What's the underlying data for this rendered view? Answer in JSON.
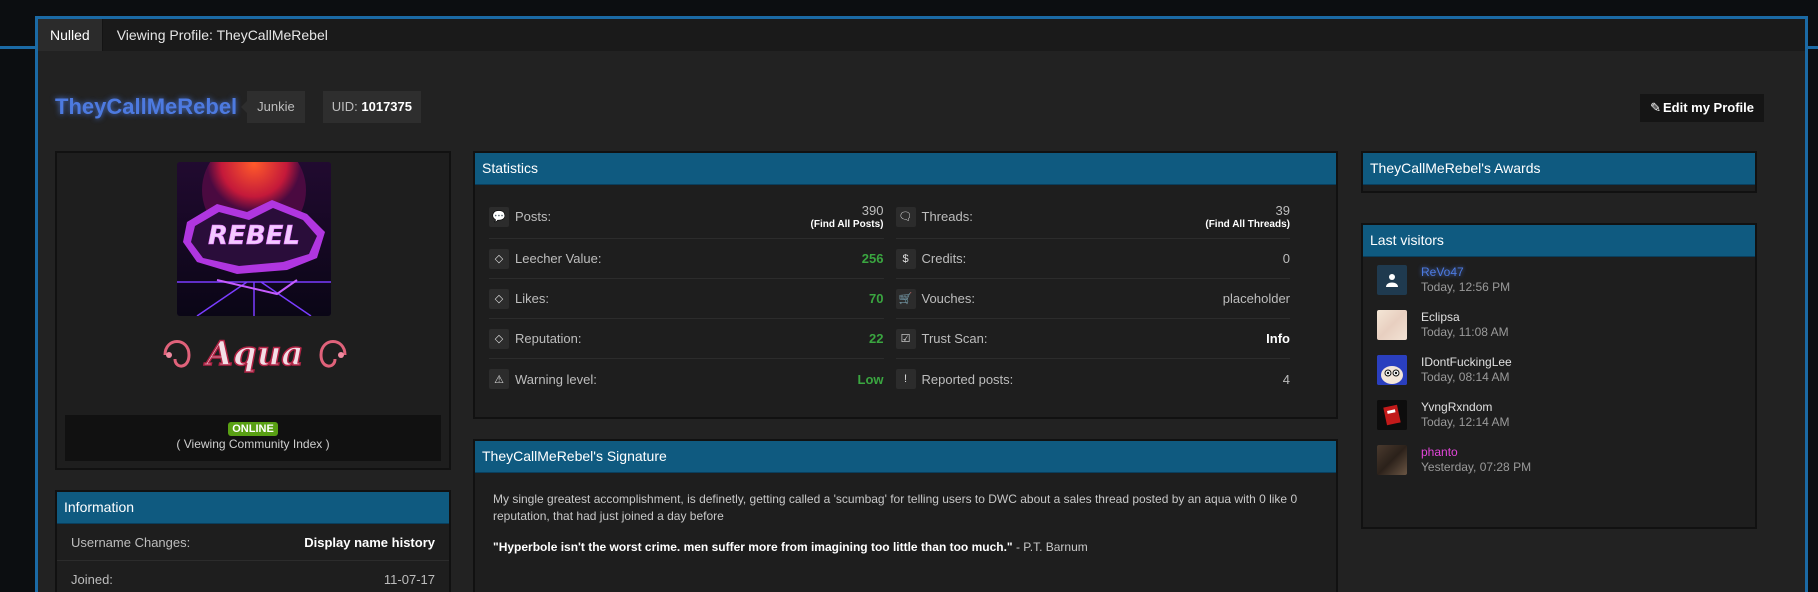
{
  "breadcrumb": {
    "home": "Nulled",
    "page": "Viewing Profile: TheyCallMeRebel"
  },
  "profile": {
    "username": "TheyCallMeRebel",
    "usergroup": "Junkie",
    "uid_label": "UID:",
    "uid_value": "1017375",
    "edit_button": "Edit my Profile",
    "avatar_text": "REBEL",
    "badge_text": "Aqua",
    "status_badge": "ONLINE",
    "status_activity": "( Viewing Community Index )"
  },
  "information": {
    "title": "Information",
    "rows": [
      {
        "label": "Username Changes:",
        "value": "Display name history"
      },
      {
        "label": "Joined:",
        "value": "11-07-17"
      }
    ]
  },
  "statistics": {
    "title": "Statistics",
    "rows": [
      {
        "left": {
          "icon": "speech-bubble-icon",
          "label": "Posts:",
          "value": "390",
          "sub": "(Find All Posts)"
        },
        "right": {
          "icon": "speech-bubbles-icon",
          "label": "Threads:",
          "value": "39",
          "sub": "(Find All Threads)"
        }
      },
      {
        "left": {
          "icon": "diamond-icon",
          "label": "Leecher Value:",
          "value": "256"
        },
        "right": {
          "icon": "dollar-icon",
          "label": "Credits:",
          "value": "0"
        }
      },
      {
        "left": {
          "icon": "diamond-icon",
          "label": "Likes:",
          "value": "70"
        },
        "right": {
          "icon": "cart-icon",
          "label": "Vouches:",
          "value": "placeholder"
        }
      },
      {
        "left": {
          "icon": "diamond-icon",
          "label": "Reputation:",
          "value": "22"
        },
        "right": {
          "icon": "checkbox-icon",
          "label": "Trust Scan:",
          "value": "Info"
        }
      },
      {
        "left": {
          "icon": "warning-icon",
          "label": "Warning level:",
          "value": "Low"
        },
        "right": {
          "icon": "exclamation-icon",
          "label": "Reported posts:",
          "value": "4"
        }
      }
    ]
  },
  "signature": {
    "title": "TheyCallMeRebel's Signature",
    "paragraph": "My single greatest accomplishment, is definetly, getting called a 'scumbag' for telling users to DWC about a sales thread posted by an aqua with 0 like 0 reputation, that had just joined a day before",
    "quote": "\"Hyperbole isn't the worst crime. men suffer more from imagining too little than too much.\"",
    "quote_author": " - P.T. Barnum"
  },
  "awards": {
    "title": "TheyCallMeRebel's Awards"
  },
  "visitors": {
    "title": "Last visitors",
    "list": [
      {
        "name": "ReVo47",
        "time": "Today, 12:56 PM"
      },
      {
        "name": "Eclipsa",
        "time": "Today, 11:08 AM"
      },
      {
        "name": "IDontFuckingLee",
        "time": "Today, 08:14 AM"
      },
      {
        "name": "YvngRxndom",
        "time": "Today, 12:14 AM"
      },
      {
        "name": "phanto",
        "time": "Yesterday, 07:28 PM"
      }
    ]
  },
  "colors": {
    "accent_blue": "#0f5a80",
    "username_blue": "#4d7ae0",
    "positive_green": "#3aa640",
    "online_green": "#59a014",
    "vip_pink": "#e246d9"
  }
}
